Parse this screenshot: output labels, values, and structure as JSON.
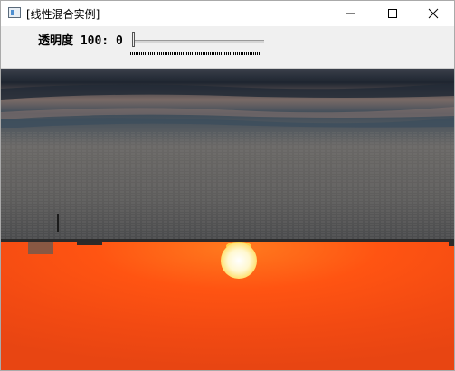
{
  "window": {
    "title": "[线性混合实例]"
  },
  "title_buttons": {
    "minimize": "minimize",
    "maximize": "maximize",
    "close": "close"
  },
  "trackbar": {
    "label": "透明度 100: 0",
    "value": 0,
    "max": 100
  },
  "image": {
    "description_icon": "sunset-image",
    "colors": {
      "sea_top": "#2a2f38",
      "sea_mid": "#6f6b6a",
      "sky_orange": "#ff5a10",
      "sun": "#fff6c8"
    }
  }
}
